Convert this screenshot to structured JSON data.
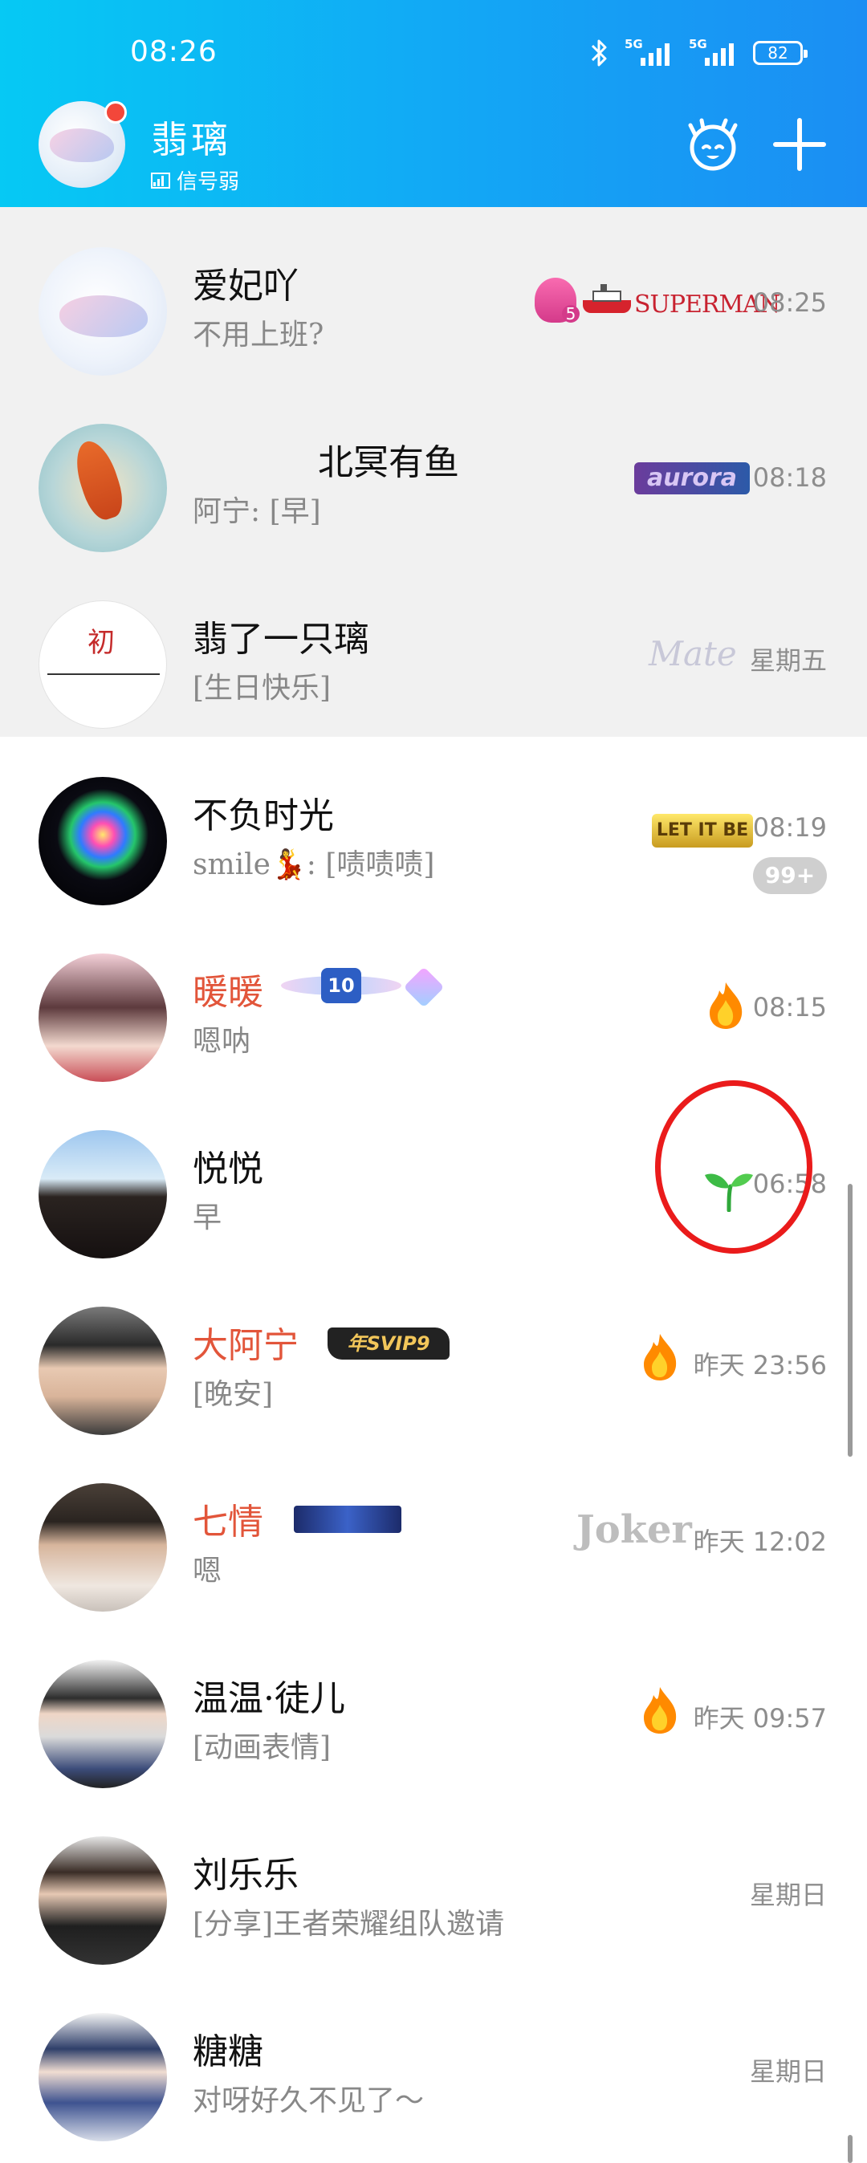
{
  "status_bar": {
    "time": "08:26",
    "net1": "5G",
    "net2": "5G",
    "battery": "82"
  },
  "profile": {
    "name": "翡璃",
    "status": "信号弱"
  },
  "chats": [
    {
      "name": "爱妃吖",
      "message": "不用上班?",
      "time": "08:25",
      "name_color": "normal",
      "badges": [
        "flame-5-badge",
        "ship-badge",
        "superman-badge"
      ],
      "superman_text": "SUPERMAN",
      "flame_num": "5"
    },
    {
      "name": "北冥有鱼",
      "message": "阿宁: [早]",
      "time": "08:18",
      "name_color": "normal",
      "badges": [
        "aurora-badge"
      ],
      "aurora_text": "aurora"
    },
    {
      "name": "翡了一只璃",
      "message": "[生日快乐]",
      "time": "星期五",
      "name_color": "normal",
      "badges": [
        "mate-badge"
      ],
      "mate_text": "Mate"
    },
    {
      "name": "不负时光",
      "message": "smile💃: [啧啧啧]",
      "time": "08:19",
      "unread": "99+",
      "name_color": "normal",
      "badges": [
        "letitbe-badge"
      ],
      "letitbe_text": "LET IT BE"
    },
    {
      "name": "暖暖",
      "message": "嗯呐",
      "time": "08:15",
      "name_color": "red",
      "badges": [
        "level-10-badge",
        "gem-badge",
        "flame-badge"
      ],
      "level_text": "10"
    },
    {
      "name": "悦悦",
      "message": "早",
      "time": "06:58",
      "name_color": "normal",
      "badges": [
        "sprout-badge"
      ]
    },
    {
      "name": "大阿宁",
      "message": "[晚安]",
      "time": "昨天 23:56",
      "name_color": "red",
      "badges": [
        "svip9-badge",
        "flame-badge"
      ],
      "svip_text": "年SVIP9"
    },
    {
      "name": "七情",
      "message": "嗯",
      "time": "昨天 12:02",
      "name_color": "red",
      "badges": [
        "vip-banner-badge",
        "joker-badge"
      ],
      "joker_text": "Joker"
    },
    {
      "name": "温温·徒儿",
      "message": "[动画表情]",
      "time": "昨天 09:57",
      "name_color": "normal",
      "badges": [
        "flame-badge"
      ]
    },
    {
      "name": "刘乐乐",
      "message": "[分享]王者荣耀组队邀请",
      "time": "星期日",
      "name_color": "normal",
      "badges": []
    },
    {
      "name": "糖糖",
      "message": "对呀好久不见了～",
      "time": "星期日",
      "name_color": "normal",
      "badges": []
    }
  ],
  "colors": {
    "header_start": "#06c9f4",
    "header_end": "#1b8ef3",
    "name_red": "#e2553a",
    "pinned_bg": "#f1f1f1",
    "annotation": "#ea1b1b"
  }
}
